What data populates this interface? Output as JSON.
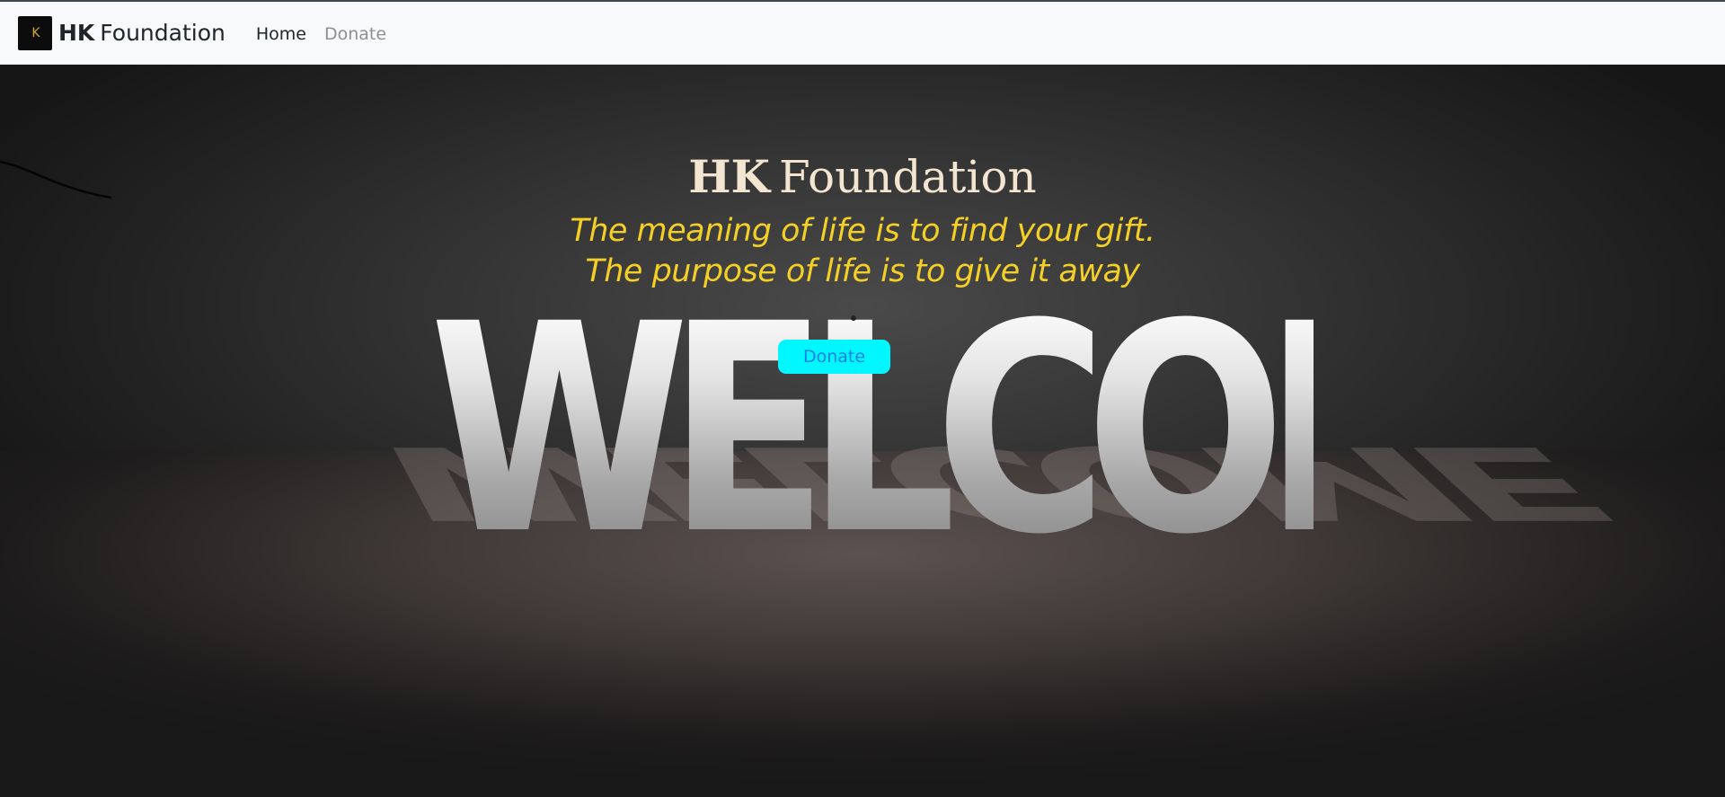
{
  "navbar": {
    "logo_glyph": "K",
    "brand_bold": "HK",
    "brand_rest": "Foundation",
    "links": [
      {
        "label": "Home",
        "active": true
      },
      {
        "label": "Donate",
        "active": false
      }
    ]
  },
  "hero": {
    "title_bold": "HK",
    "title_rest": "Foundation",
    "tagline_line1": "The meaning of life is to find your gift.",
    "tagline_line2": "The purpose of life is to give it away",
    "background_word": "WELCOME",
    "donate_button_label": "Donate"
  },
  "colors": {
    "navbar_bg": "#f8f9fa",
    "title": "#f3e5cf",
    "tagline": "#f4cf27",
    "donate_bg": "#00f7ff",
    "donate_text": "#1a7ee8",
    "logo_accent": "#d6a531"
  }
}
